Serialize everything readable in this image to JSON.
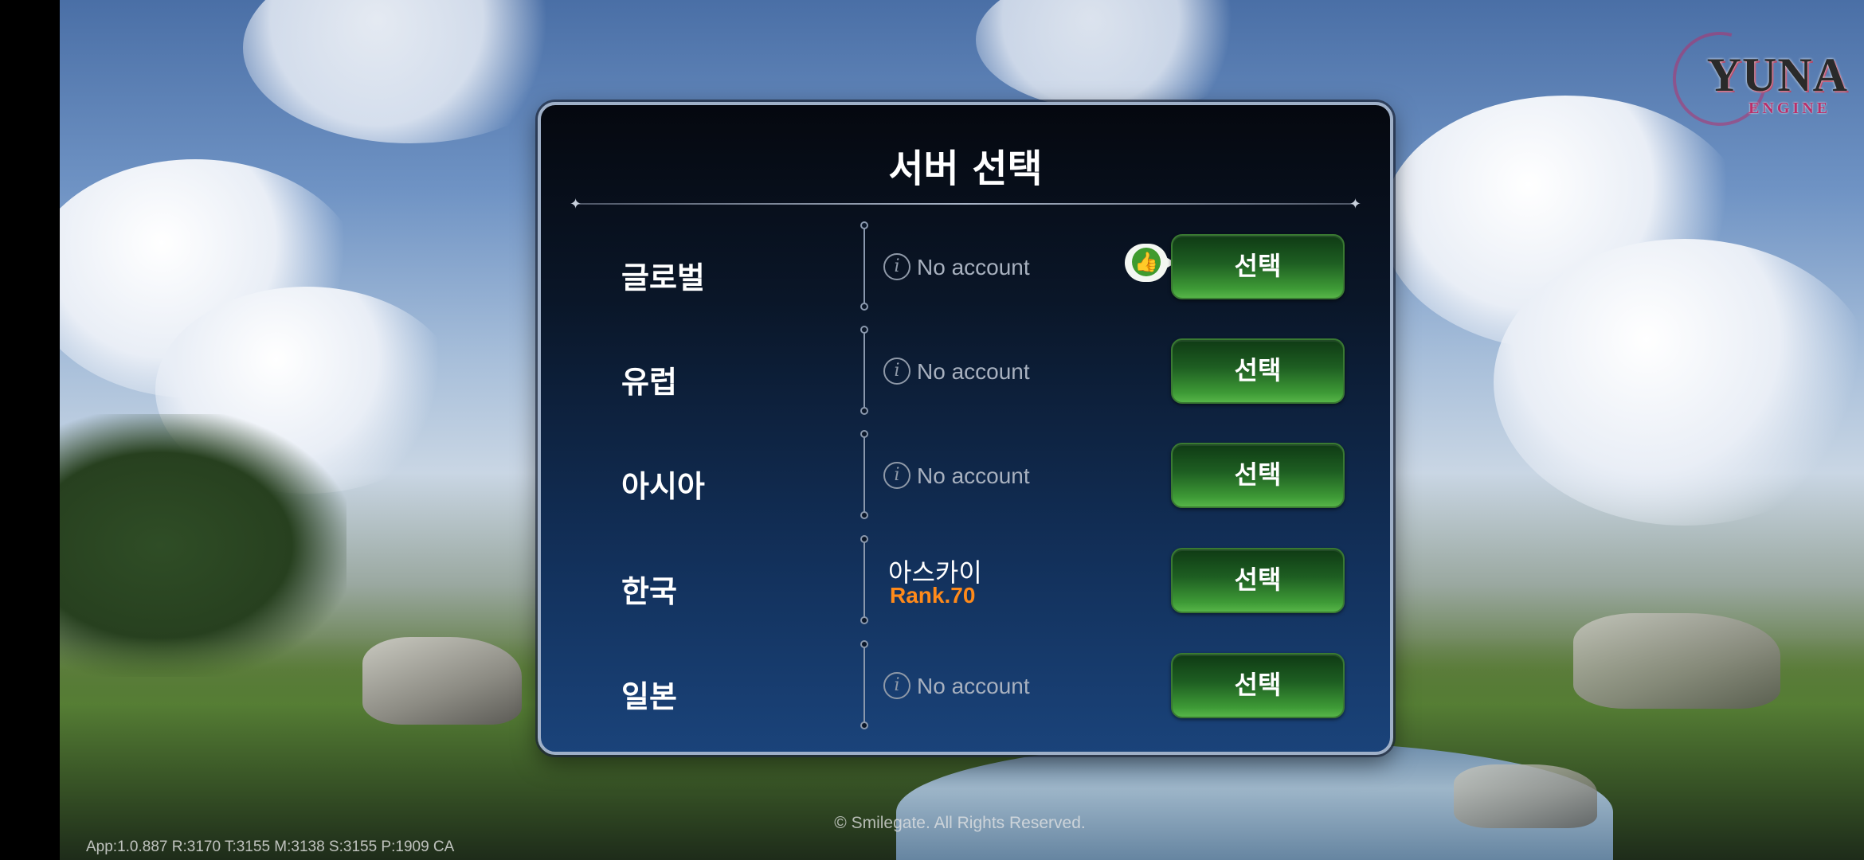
{
  "panel": {
    "title": "서버 선택",
    "servers": [
      {
        "region": "글로벌",
        "status": "No account",
        "recommended": true,
        "button": "선택"
      },
      {
        "region": "유럽",
        "status": "No account",
        "recommended": false,
        "button": "선택"
      },
      {
        "region": "아시아",
        "status": "No account",
        "recommended": false,
        "button": "선택"
      },
      {
        "region": "한국",
        "character": "아스카이",
        "rank": "Rank.70",
        "button": "선택"
      },
      {
        "region": "일본",
        "status": "No account",
        "recommended": false,
        "button": "선택"
      }
    ]
  },
  "logo": {
    "title": "YUNA",
    "subtitle": "ENGINE"
  },
  "footer": {
    "copyright": "© Smilegate. All Rights Reserved.",
    "version": "App:1.0.887  R:3170 T:3155 M:3138 S:3155 P:1909   CA"
  },
  "colors": {
    "button_green": "#2f7d2b",
    "rank_orange": "#ff8a1a",
    "panel_dark": "#0a1628"
  },
  "icons": {
    "info": "info-icon",
    "recommend": "thumbs-up-icon"
  }
}
